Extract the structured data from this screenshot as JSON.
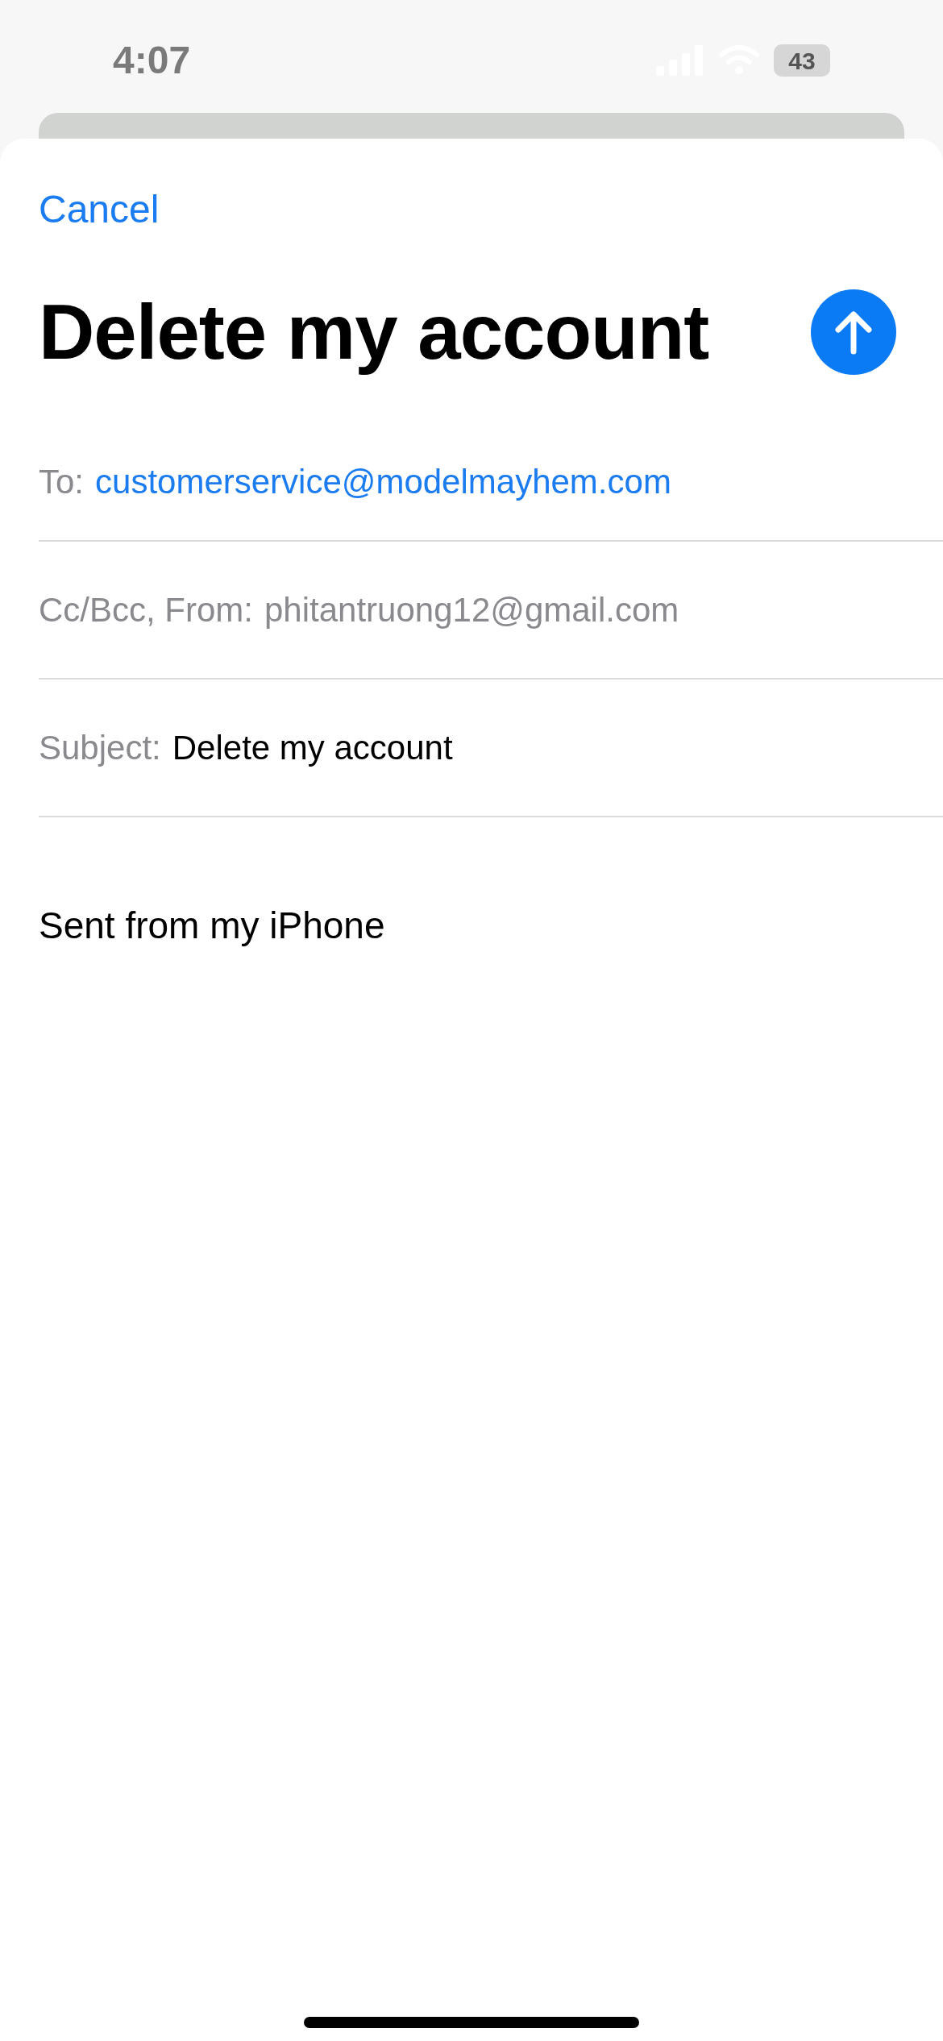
{
  "status_bar": {
    "time": "4:07",
    "battery": "43"
  },
  "cancel": "Cancel",
  "title": "Delete my account",
  "fields": [
    {
      "label": "To:",
      "value": "customerservice@modelmayhem.com",
      "kind": "recipient"
    },
    {
      "label": "Cc/Bcc, From:",
      "value": "phitantruong12@gmail.com",
      "kind": "muted"
    },
    {
      "label": "Subject:",
      "value": "Delete my account",
      "kind": "plain"
    }
  ],
  "body": "Sent from my iPhone"
}
